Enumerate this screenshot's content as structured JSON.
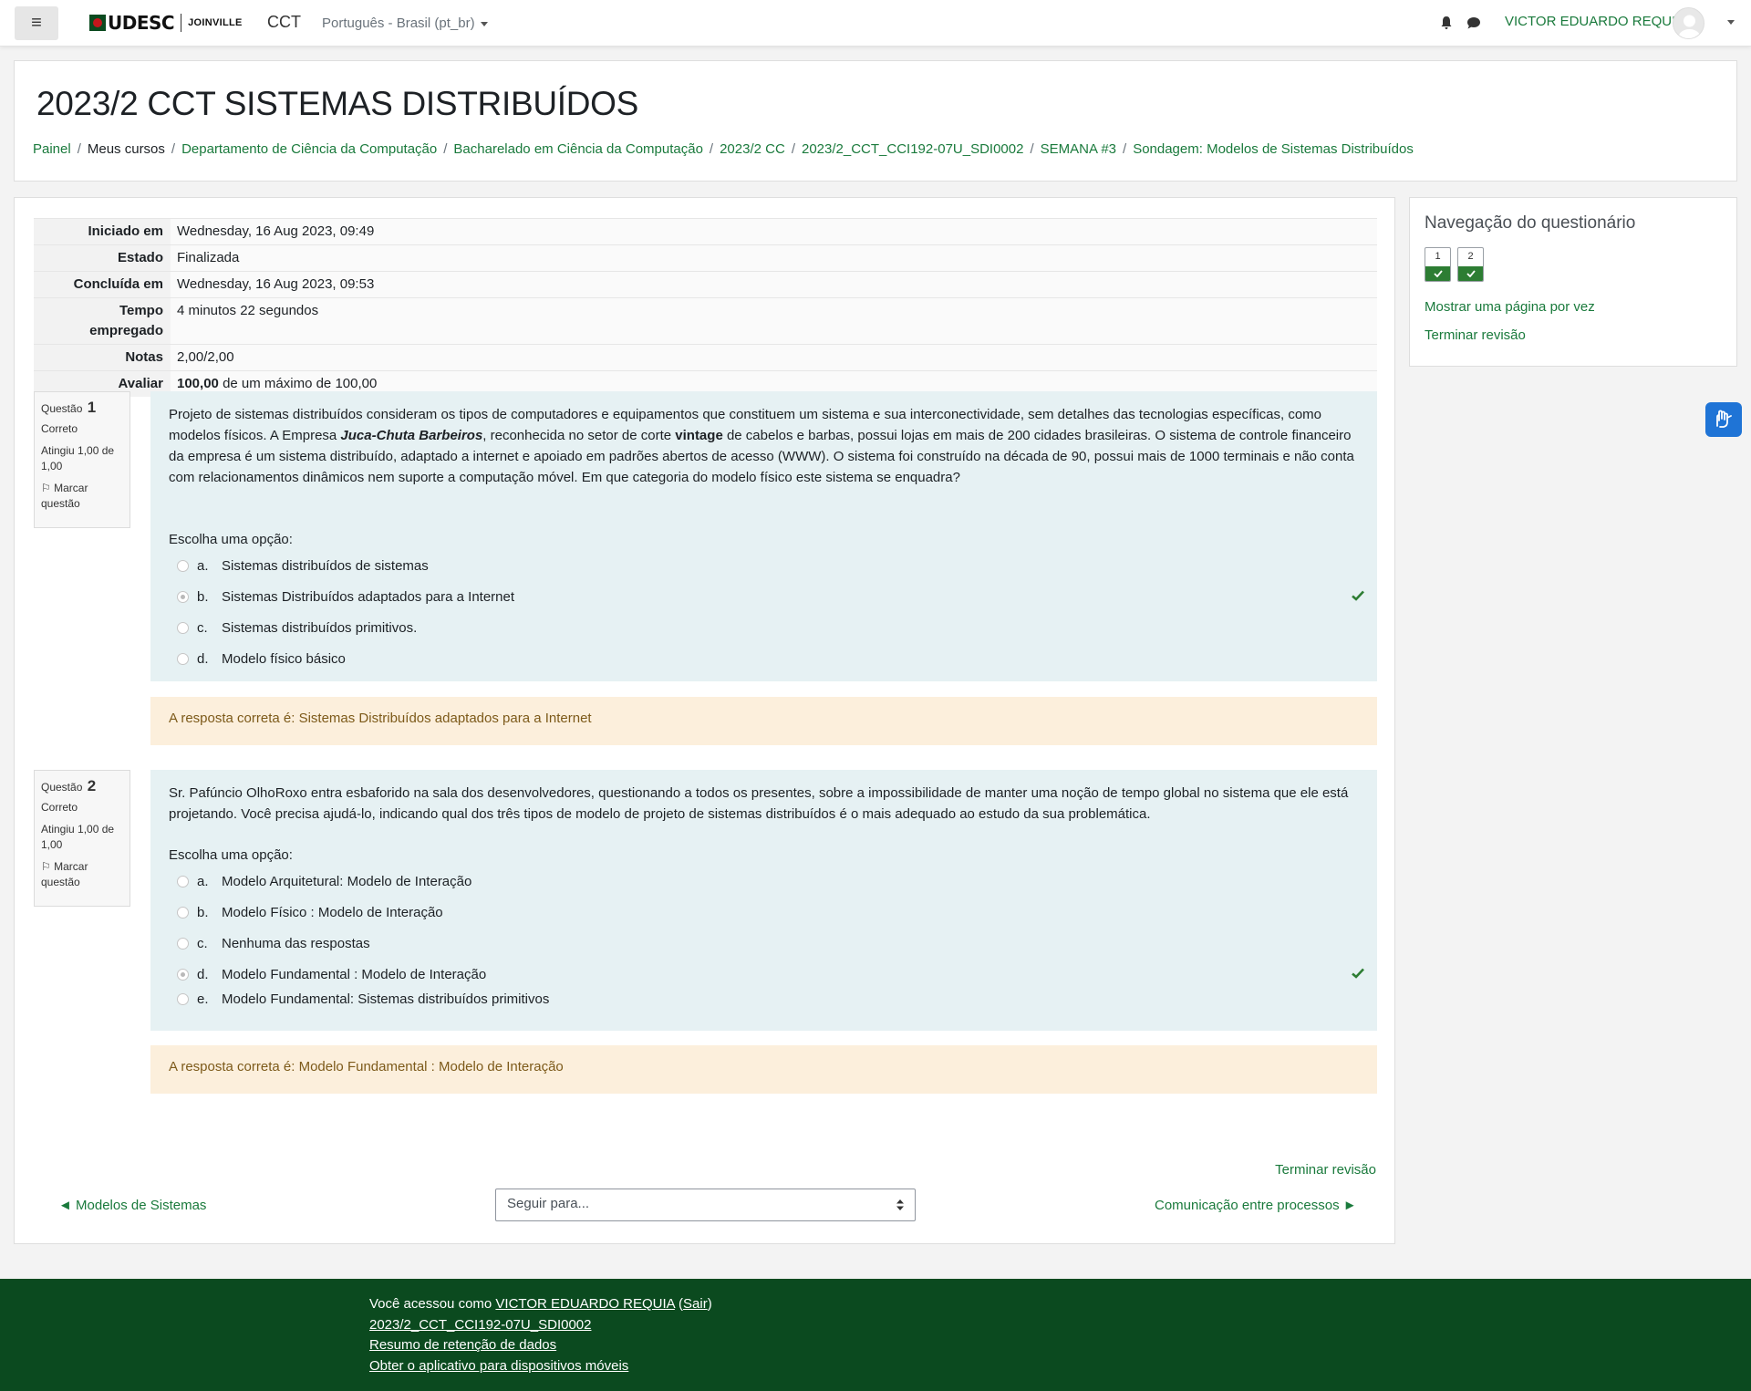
{
  "navbar": {
    "menu_icon": "hamburger-icon",
    "logo_text": "UDESC",
    "logo_city": "JOINVILLE",
    "site": "CCT",
    "language": "Português - Brasil (pt_br)",
    "user": "VICTOR EDUARDO REQUIA",
    "accent_color": "#1a7a3c"
  },
  "header": {
    "title": "2023/2 CCT SISTEMAS DISTRIBUÍDOS",
    "breadcrumb": [
      "Painel",
      "Meus cursos",
      "Departamento de Ciência da Computação",
      "Bacharelado em Ciência da Computação",
      "2023/2 CC",
      "2023/2_CCT_CCI192-07U_SDI0002",
      "SEMANA #3",
      "Sondagem: Modelos de Sistemas Distribuídos"
    ]
  },
  "summary": {
    "started_label": "Iniciado em",
    "started_value": "Wednesday, 16 Aug 2023, 09:49",
    "state_label": "Estado",
    "state_value": "Finalizada",
    "completed_label": "Concluída em",
    "completed_value": "Wednesday, 16 Aug 2023, 09:53",
    "time_label_1": "Tempo",
    "time_label_2": "empregado",
    "time_value": "4 minutos 22 segundos",
    "marks_label": "Notas",
    "marks_value": "2,00/2,00",
    "grade_label": "Avaliar",
    "grade_value_bold": "100,00",
    "grade_value_rest": "de um máximo de 100,00"
  },
  "questions": [
    {
      "label": "Questão",
      "number": "1",
      "state": "Correto",
      "grade": "Atingiu 1,00 de 1,00",
      "flag": "Marcar questão",
      "text_1": "Projeto de sistemas distribuídos consideram os tipos de computadores e equipamentos que constituem um sistema e sua interconectividade, sem detalhes das tecnologias específicas, como modelos físicos. A Empresa ",
      "text_bold_italic": "Juca-Chuta Barbeiros",
      "text_2": ", reconhecida no setor de corte ",
      "text_bold": "vintage",
      "text_3": " de cabelos e barbas, possui lojas em mais de 200 cidades brasileiras. O sistema de controle financeiro da empresa é um sistema distribuído, adaptado a internet e apoiado em padrões abertos de acesso (WWW). O sistema foi construído na década de 90, possui mais de 1000 terminais e não conta com relacionamentos dinâmicos nem suporte a computação móvel. Em que categoria do modelo físico este sistema se enquadra?",
      "prompt": "Escolha uma opção:",
      "options": [
        {
          "letter": "a.",
          "text": "Sistemas distribuídos de sistemas"
        },
        {
          "letter": "b.",
          "text": "Sistemas Distribuídos adaptados para a Internet"
        },
        {
          "letter": "c.",
          "text": "Sistemas distribuídos primitivos."
        },
        {
          "letter": "d.",
          "text": "Modelo físico básico"
        }
      ],
      "feedback": "A resposta correta é: Sistemas Distribuídos adaptados para a Internet"
    },
    {
      "label": "Questão",
      "number": "2",
      "state": "Correto",
      "grade": "Atingiu 1,00 de 1,00",
      "flag": "Marcar questão",
      "text": "Sr. Pafúncio OlhoRoxo entra esbaforido na sala dos desenvolvedores, questionando a todos os presentes, sobre a impossibilidade de manter uma noção de tempo global no sistema que ele está projetando. Você precisa ajudá-lo, indicando qual dos três tipos de modelo de projeto de sistemas distribuídos é o mais adequado ao estudo da sua problemática.",
      "prompt": "Escolha uma opção:",
      "options": [
        {
          "letter": "a.",
          "text": "Modelo Arquitetural: Modelo de Interação"
        },
        {
          "letter": "b.",
          "text": "Modelo Físico : Modelo de Interação"
        },
        {
          "letter": "c.",
          "text": "Nenhuma das respostas"
        },
        {
          "letter": "d.",
          "text": "Modelo Fundamental : Modelo de Interação"
        },
        {
          "letter": "e.",
          "text": "Modelo Fundamental: Sistemas distribuídos primitivos"
        }
      ],
      "feedback": "A resposta correta é: Modelo Fundamental : Modelo de Interação"
    }
  ],
  "footer_nav": {
    "end_review": "Terminar revisão",
    "prev": "◄ Modelos de Sistemas",
    "jump_placeholder": "Seguir para...",
    "next": "Comunicação entre processos ►"
  },
  "sidebar": {
    "title": "Navegação do questionário",
    "buttons": [
      "1",
      "2"
    ],
    "show_one_page": "Mostrar uma página por vez",
    "end_review": "Terminar revisão"
  },
  "footer": {
    "logged_in_prefix": "Você acessou como ",
    "user": "VICTOR EDUARDO REQUIA",
    "logout_open": " (",
    "logout": "Sair",
    "logout_close": ")",
    "course": "2023/2_CCT_CCI192-07U_SDI0002",
    "data_retention": "Resumo de retenção de dados",
    "mobile_app": "Obter o aplicativo para dispositivos móveis",
    "bg_color": "#0b4a1f"
  }
}
